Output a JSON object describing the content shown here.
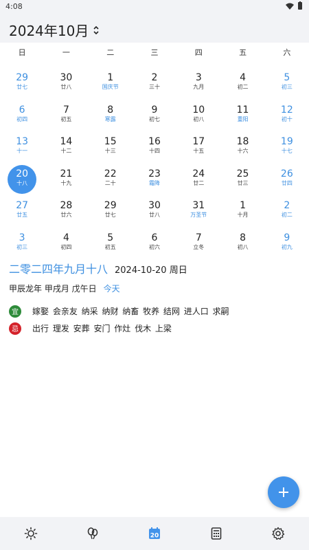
{
  "status": {
    "time": "4:08"
  },
  "header": {
    "title": "2024年10月"
  },
  "weekdays": [
    "日",
    "一",
    "二",
    "三",
    "四",
    "五",
    "六"
  ],
  "days": [
    {
      "n": "29",
      "l": "廿七"
    },
    {
      "n": "30",
      "l": "廿八"
    },
    {
      "n": "1",
      "l": "国庆节",
      "f": true
    },
    {
      "n": "2",
      "l": "三十"
    },
    {
      "n": "3",
      "l": "九月"
    },
    {
      "n": "4",
      "l": "初二"
    },
    {
      "n": "5",
      "l": "初三"
    },
    {
      "n": "6",
      "l": "初四"
    },
    {
      "n": "7",
      "l": "初五"
    },
    {
      "n": "8",
      "l": "寒露",
      "f": true
    },
    {
      "n": "9",
      "l": "初七"
    },
    {
      "n": "10",
      "l": "初八"
    },
    {
      "n": "11",
      "l": "重阳",
      "f": true
    },
    {
      "n": "12",
      "l": "初十"
    },
    {
      "n": "13",
      "l": "十一"
    },
    {
      "n": "14",
      "l": "十二"
    },
    {
      "n": "15",
      "l": "十三"
    },
    {
      "n": "16",
      "l": "十四"
    },
    {
      "n": "17",
      "l": "十五"
    },
    {
      "n": "18",
      "l": "十六"
    },
    {
      "n": "19",
      "l": "十七"
    },
    {
      "n": "20",
      "l": "十八",
      "today": true
    },
    {
      "n": "21",
      "l": "十九"
    },
    {
      "n": "22",
      "l": "二十"
    },
    {
      "n": "23",
      "l": "霜降",
      "f": true
    },
    {
      "n": "24",
      "l": "廿二"
    },
    {
      "n": "25",
      "l": "廿三"
    },
    {
      "n": "26",
      "l": "廿四"
    },
    {
      "n": "27",
      "l": "廿五"
    },
    {
      "n": "28",
      "l": "廿六"
    },
    {
      "n": "29",
      "l": "廿七"
    },
    {
      "n": "30",
      "l": "廿八"
    },
    {
      "n": "31",
      "l": "万圣节",
      "f": true
    },
    {
      "n": "1",
      "l": "十月"
    },
    {
      "n": "2",
      "l": "初二"
    },
    {
      "n": "3",
      "l": "初三"
    },
    {
      "n": "4",
      "l": "初四"
    },
    {
      "n": "5",
      "l": "初五"
    },
    {
      "n": "6",
      "l": "初六"
    },
    {
      "n": "7",
      "l": "立冬"
    },
    {
      "n": "8",
      "l": "初八"
    },
    {
      "n": "9",
      "l": "初九"
    }
  ],
  "detail": {
    "lunar_full": "二零二四年九月十八",
    "gregorian": "2024-10-20 周日",
    "ganzhi": "甲辰龙年 甲戌月 戊午日",
    "today_label": "今天",
    "yi_label": "宜",
    "yi_text": "嫁娶 会亲友 纳采 纳财 纳畜 牧养 结网 进人口 求嗣",
    "ji_label": "忌",
    "ji_text": "出行 理发 安葬 安门 作灶 伐木 上梁"
  },
  "nav": {
    "items": [
      "sun-icon",
      "balloon-icon",
      "calendar-icon",
      "calculator-icon",
      "gear-icon"
    ],
    "calendar_day": "20"
  },
  "colors": {
    "accent": "#4293ea",
    "yi": "#2e8b3a",
    "ji": "#d4222a",
    "bar": "#f2f3f6"
  }
}
